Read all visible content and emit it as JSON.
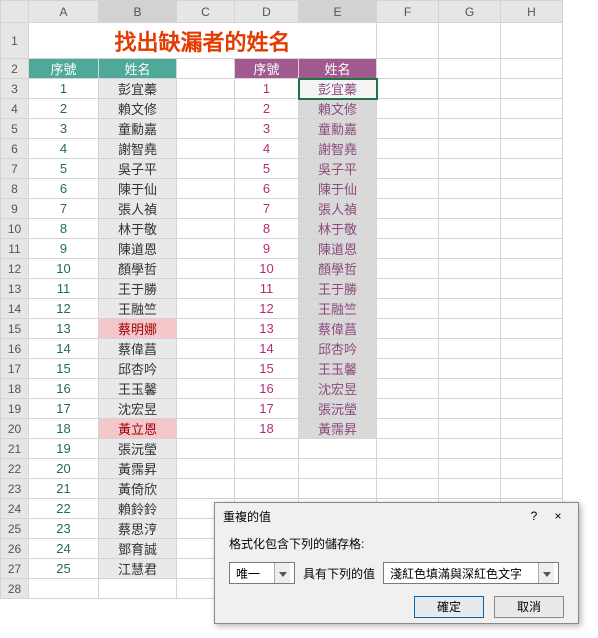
{
  "columns": [
    "A",
    "B",
    "C",
    "D",
    "E",
    "F",
    "G",
    "H"
  ],
  "title": "找出缺漏者的姓名",
  "headers1": {
    "num": "序號",
    "name": "姓名"
  },
  "headers2": {
    "num": "序號",
    "name": "姓名"
  },
  "data1": [
    {
      "n": "1",
      "name": "彭宜蓁"
    },
    {
      "n": "2",
      "name": "賴文修"
    },
    {
      "n": "3",
      "name": "童勳嘉"
    },
    {
      "n": "4",
      "name": "謝智堯"
    },
    {
      "n": "5",
      "name": "吳子平"
    },
    {
      "n": "6",
      "name": "陳于仙"
    },
    {
      "n": "7",
      "name": "張人禎"
    },
    {
      "n": "8",
      "name": "林于敬"
    },
    {
      "n": "9",
      "name": "陳道恩"
    },
    {
      "n": "10",
      "name": "顏學哲"
    },
    {
      "n": "11",
      "name": "王于勝"
    },
    {
      "n": "12",
      "name": "王融竺"
    },
    {
      "n": "13",
      "name": "蔡明娜",
      "hlt": true
    },
    {
      "n": "14",
      "name": "蔡偉菖"
    },
    {
      "n": "15",
      "name": "邱杏吟"
    },
    {
      "n": "16",
      "name": "王玉馨"
    },
    {
      "n": "17",
      "name": "沈宏昱"
    },
    {
      "n": "18",
      "name": "黃立恩",
      "hlt": true
    },
    {
      "n": "19",
      "name": "張沅瑩"
    },
    {
      "n": "20",
      "name": "黃霈昇"
    },
    {
      "n": "21",
      "name": "黃倚欣"
    },
    {
      "n": "22",
      "name": "賴鈴鈴"
    },
    {
      "n": "23",
      "name": "蔡思涥"
    },
    {
      "n": "24",
      "name": "鄧育誠"
    },
    {
      "n": "25",
      "name": "江慧君"
    }
  ],
  "data2": [
    {
      "n": "1",
      "name": "彭宜蓁",
      "sel": true
    },
    {
      "n": "2",
      "name": "賴文修"
    },
    {
      "n": "3",
      "name": "童勳嘉"
    },
    {
      "n": "4",
      "name": "謝智堯"
    },
    {
      "n": "5",
      "name": "吳子平"
    },
    {
      "n": "6",
      "name": "陳于仙"
    },
    {
      "n": "7",
      "name": "張人禎"
    },
    {
      "n": "8",
      "name": "林于敬"
    },
    {
      "n": "9",
      "name": "陳道恩"
    },
    {
      "n": "10",
      "name": "顏學哲"
    },
    {
      "n": "11",
      "name": "王于勝"
    },
    {
      "n": "12",
      "name": "王融竺"
    },
    {
      "n": "13",
      "name": "蔡偉菖"
    },
    {
      "n": "14",
      "name": "邱杏吟"
    },
    {
      "n": "15",
      "name": "王玉馨"
    },
    {
      "n": "16",
      "name": "沈宏昱"
    },
    {
      "n": "17",
      "name": "張沅瑩"
    },
    {
      "n": "18",
      "name": "黃霈昇"
    }
  ],
  "dialog": {
    "title": "重複的值",
    "help": "?",
    "close": "×",
    "label": "格式化包含下列的儲存格:",
    "combo1": "唯一",
    "midtext": "具有下列的值",
    "combo2": "淺紅色填滿與深紅色文字",
    "ok": "確定",
    "cancel": "取消"
  }
}
